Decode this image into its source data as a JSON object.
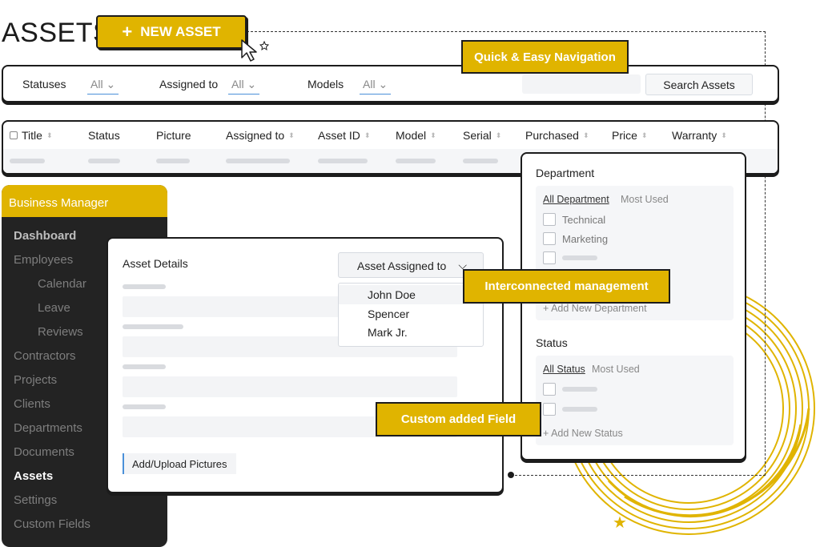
{
  "page": {
    "title": "ASSETS"
  },
  "new_asset": {
    "label": "NEW ASSET",
    "icon": "plus-icon"
  },
  "callouts": {
    "navigation": "Quick & Easy Navigation",
    "interconnected": "Interconnected management",
    "custom_field": "Custom added Field"
  },
  "filters": {
    "statuses": {
      "label": "Statuses",
      "value": "All"
    },
    "assigned": {
      "label": "Assigned to",
      "value": "All"
    },
    "models": {
      "label": "Models",
      "value": "All"
    },
    "search_button": "Search Assets"
  },
  "table": {
    "columns": [
      "Title",
      "Status",
      "Picture",
      "Assigned to",
      "Asset ID",
      "Model",
      "Serial",
      "Purchased",
      "Price",
      "Warranty"
    ]
  },
  "sidebar": {
    "title": "Business Manager",
    "items": [
      {
        "label": "Dashboard"
      },
      {
        "label": "Employees"
      },
      {
        "label": "Calendar"
      },
      {
        "label": "Leave"
      },
      {
        "label": "Reviews"
      },
      {
        "label": "Contractors"
      },
      {
        "label": "Projects"
      },
      {
        "label": "Clients"
      },
      {
        "label": "Departments"
      },
      {
        "label": "Documents"
      },
      {
        "label": "Assets"
      },
      {
        "label": "Settings"
      },
      {
        "label": "Custom Fields"
      }
    ]
  },
  "asset_details": {
    "title": "Asset Details",
    "assigned_button": "Asset Assigned to",
    "dropdown_options": [
      "John Doe",
      "Spencer",
      "Mark Jr."
    ],
    "upload_label": "Add/Upload Pictures"
  },
  "department": {
    "title": "Department",
    "tab_all": "All Department",
    "tab_most": "Most Used",
    "options": [
      "Technical",
      "Marketing"
    ],
    "add_new": "+ Add New Department"
  },
  "status": {
    "title": "Status",
    "tab_all": "All Status",
    "tab_most": "Most Used",
    "add_new": "+ Add New Status"
  },
  "colors": {
    "accent": "#e0b400",
    "dark": "#232323",
    "outline": "#1c1c1c"
  }
}
